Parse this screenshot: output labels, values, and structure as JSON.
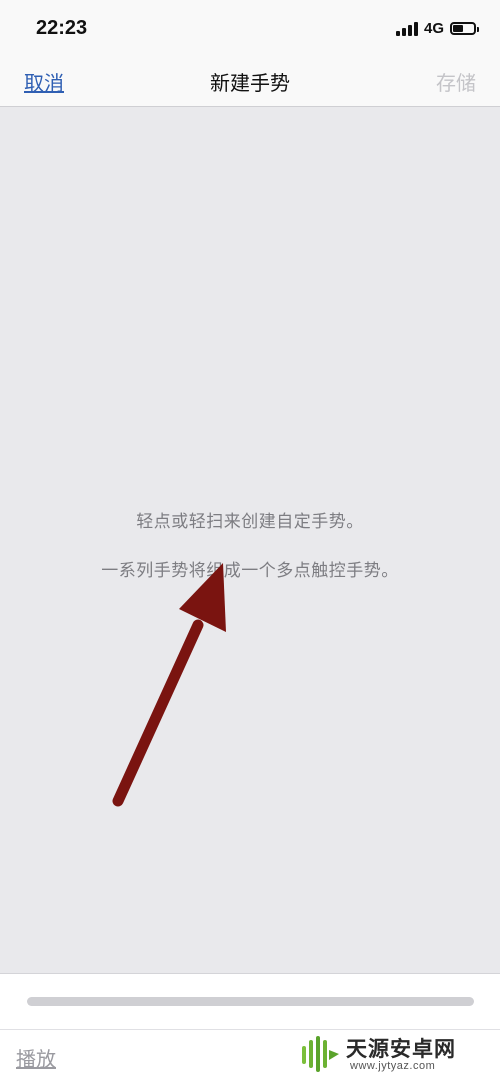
{
  "status_bar": {
    "time": "22:23",
    "network": "4G",
    "battery_level": 0.45
  },
  "nav": {
    "cancel_label": "取消",
    "title": "新建手势",
    "save_label": "存储"
  },
  "canvas": {
    "hint_line_1": "轻点或轻扫来创建自定手势。",
    "hint_line_2": "一系列手势将组成一个多点触控手势。"
  },
  "annotation": {
    "arrow_color": "#7a1410"
  },
  "bottom": {
    "play_label": "播放"
  },
  "watermark": {
    "name": "天源安卓网",
    "url": "www.jytyaz.com"
  },
  "colors": {
    "link": "#2f5fb3",
    "disabled": "#c4c4c8",
    "canvas_bg": "#e9e9ec"
  }
}
